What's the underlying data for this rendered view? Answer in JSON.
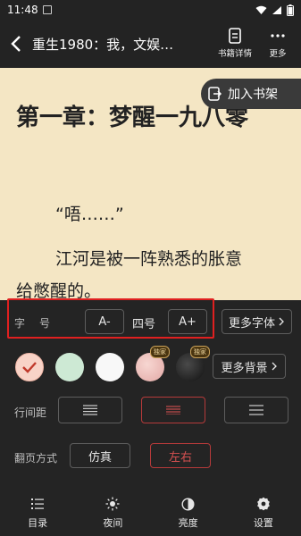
{
  "status": {
    "time": "11:48"
  },
  "header": {
    "title": "重生1980：我，文娱…",
    "detail_label": "书籍详情",
    "more_label": "更多"
  },
  "reading": {
    "chapter_title": "第一章：梦醒一九八零",
    "para1": "“唔……”",
    "para2": "江河是被一阵熟悉的胀意",
    "para3": "给憋醒的。",
    "add_shelf": "加入书架"
  },
  "settings": {
    "font_size_label": "字　号",
    "font_minus": "A-",
    "font_value": "四号",
    "font_plus": "A+",
    "more_fonts": "更多字体",
    "more_bg": "更多背景",
    "badge": "独家",
    "line_spacing_label": "行间距",
    "page_turn_label": "翻页方式",
    "page_turn_options": [
      "仿真",
      "左右"
    ],
    "selected_page_turn": "左右",
    "selected_line_spacing": 1
  },
  "bottom_nav": {
    "items": [
      {
        "label": "目录",
        "icon": "list-icon"
      },
      {
        "label": "夜间",
        "icon": "sun-icon"
      },
      {
        "label": "亮度",
        "icon": "contrast-icon"
      },
      {
        "label": "设置",
        "icon": "gear-icon"
      }
    ]
  },
  "colors": {
    "accent": "#d45050",
    "panel_bg": "#242424",
    "page_bg": "#f4e6c4",
    "highlight": "#e02020"
  }
}
